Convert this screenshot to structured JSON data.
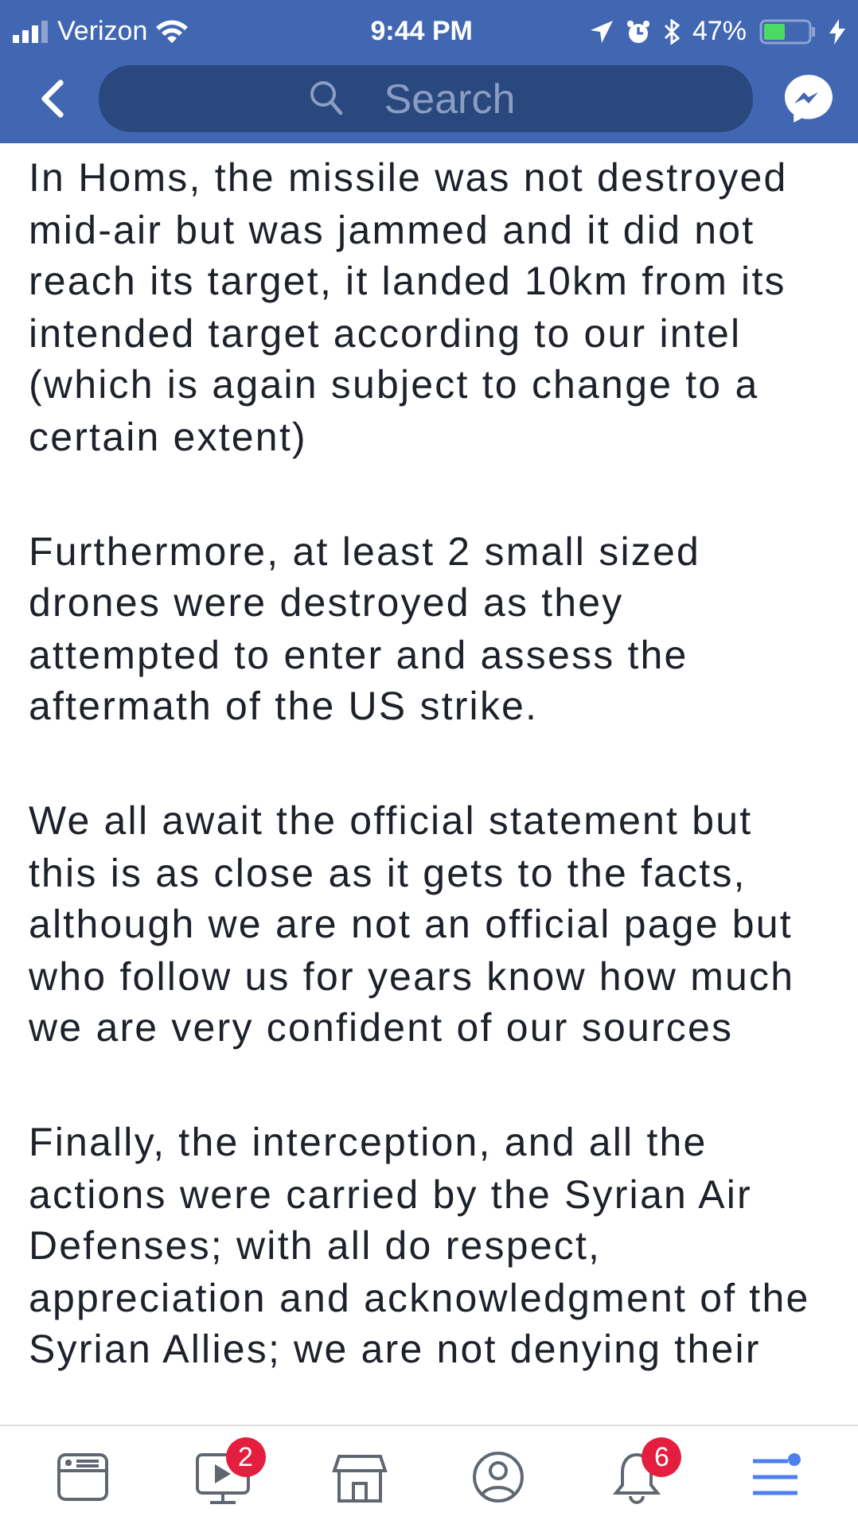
{
  "status_bar": {
    "carrier": "Verizon",
    "time": "9:44 PM",
    "battery": "47%"
  },
  "nav_bar": {
    "search": {
      "placeholder": "Search"
    }
  },
  "post": {
    "paragraphs": [
      {
        "lines": [
          "In Homs, the missile was not destroyed",
          "mid-air but was jammed and it did not",
          "reach its target, it landed 10km from its",
          "intended target according to our intel",
          "(which is again subject to change to a",
          "certain extent)"
        ]
      },
      {
        "lines": [
          "Furthermore, at least 2 small sized",
          "drones were destroyed as they",
          "attempted to enter and assess the",
          "aftermath of the US strike."
        ]
      },
      {
        "lines": [
          "We all await the official statement but",
          "this is as close as it gets to the facts,",
          "although we are not an official page but",
          "who follow us for years know how much",
          "we are very confident of our sources"
        ]
      },
      {
        "lines": [
          "Finally, the interception, and all the",
          "actions were carried by the Syrian Air",
          "Defenses; with all do respect,",
          "appreciation and acknowledgment of the",
          "Syrian Allies; we are not denying their"
        ]
      }
    ]
  },
  "tab_bar": [
    {
      "kind": "news",
      "selected": false
    },
    {
      "kind": "video",
      "selected": false,
      "badge": "2"
    },
    {
      "kind": "market",
      "selected": false
    },
    {
      "kind": "profile",
      "selected": false
    },
    {
      "kind": "bell",
      "selected": false,
      "badge": "6"
    },
    {
      "kind": "menu",
      "selected": true
    }
  ]
}
